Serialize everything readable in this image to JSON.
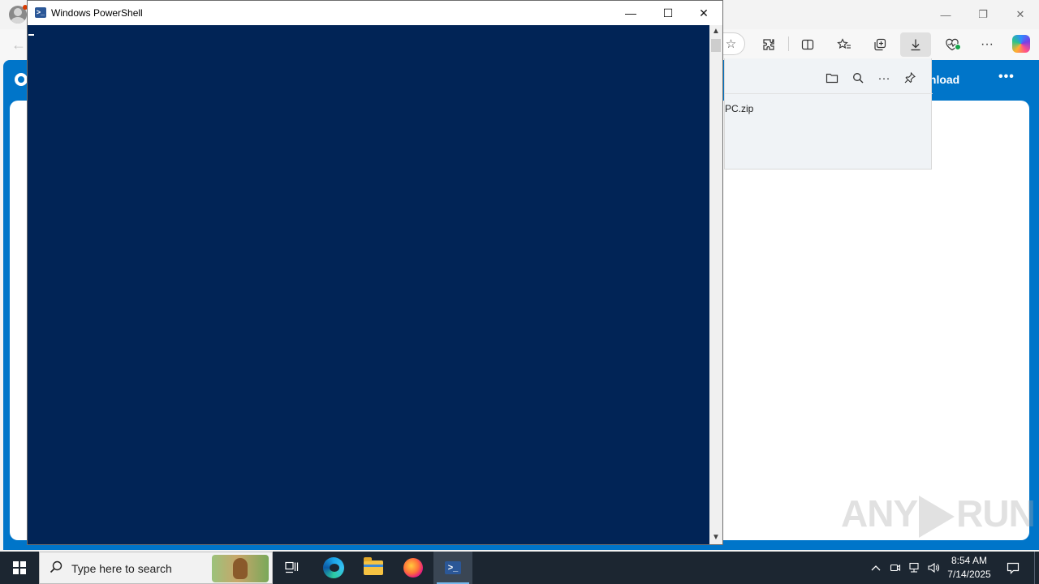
{
  "browser": {
    "window_controls": {
      "minimize": "—",
      "restore": "❐",
      "close": "✕"
    },
    "toolbar_icons": [
      "favorite-star",
      "extensions",
      "split-screen",
      "favorites",
      "collections",
      "downloads",
      "browser-essentials",
      "settings-more",
      "copilot"
    ],
    "downloads_panel": {
      "header_icons": [
        "open-folder",
        "search",
        "more",
        "pin"
      ],
      "file_name_fragment": "PC.zip"
    },
    "site": {
      "download_fragment": "wnload",
      "more": "•••",
      "accent_color": "#0075c9"
    }
  },
  "powershell": {
    "title": "Windows PowerShell",
    "console_background": "#012456",
    "controls": {
      "minimize": "—",
      "maximize": "☐",
      "close": "✕"
    }
  },
  "watermark": {
    "left": "ANY",
    "right": "RUN"
  },
  "taskbar": {
    "search_placeholder": "Type here to search",
    "pinned_apps": [
      "task-view",
      "microsoft-edge",
      "file-explorer",
      "firefox",
      "windows-powershell"
    ],
    "active_app": "windows-powershell",
    "clock": {
      "time": "8:54 AM",
      "date": "7/14/2025"
    },
    "tray_icons": [
      "show-hidden-chevron",
      "meet-now",
      "network",
      "volume"
    ]
  }
}
